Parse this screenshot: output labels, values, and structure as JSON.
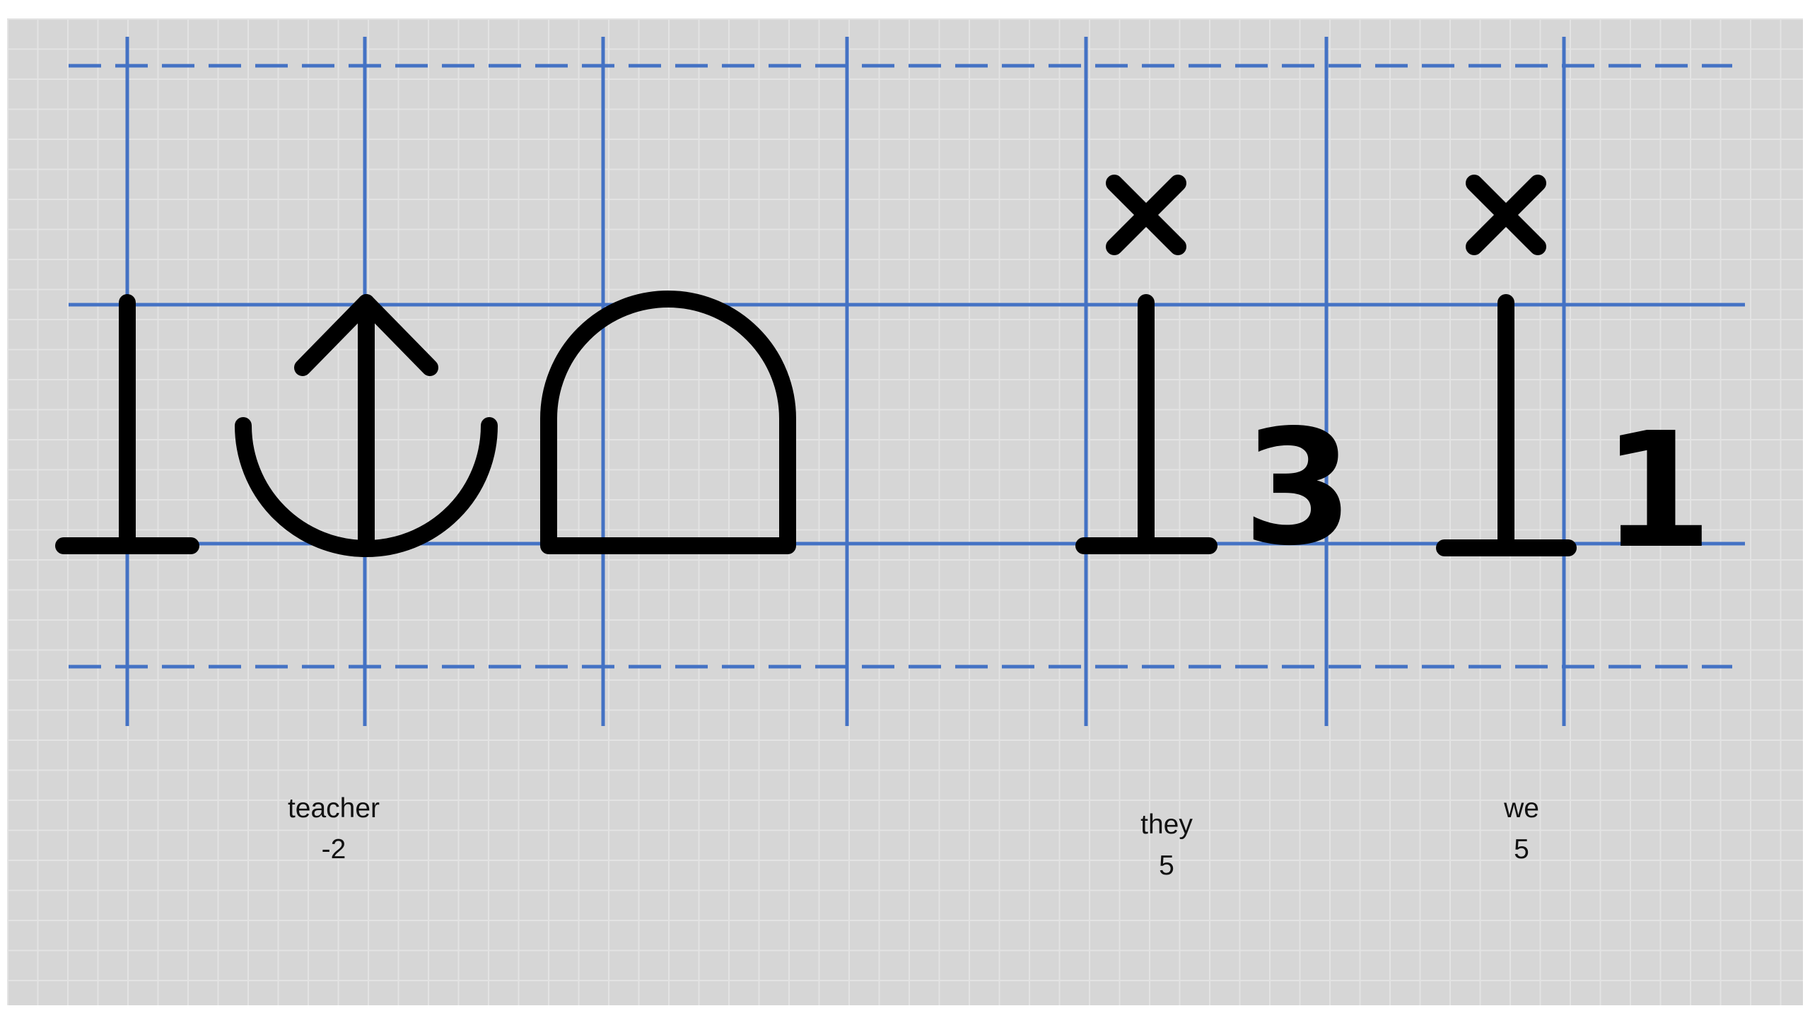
{
  "colors": {
    "paper": "#d6d6d6",
    "paper_grid": "#e3e3e3",
    "guide": "#4472c4",
    "ink": "#000000",
    "label_text": "#111111"
  },
  "glyph_words": [
    {
      "id": "word-teacher",
      "word": "teacher",
      "value": "-2",
      "glyphs": [
        "stand-line-glyph",
        "anchor-up-arrow-glyph",
        "dome-arch-glyph"
      ]
    },
    {
      "id": "word-they",
      "word": "they",
      "value": "5",
      "glyphs": [
        "x-mark-glyph",
        "stand-line-glyph",
        "digit-glyph"
      ],
      "digit": "3"
    },
    {
      "id": "word-we",
      "word": "we",
      "value": "5",
      "glyphs": [
        "x-mark-glyph",
        "stand-line-glyph",
        "digit-glyph"
      ],
      "digit": "1"
    }
  ]
}
